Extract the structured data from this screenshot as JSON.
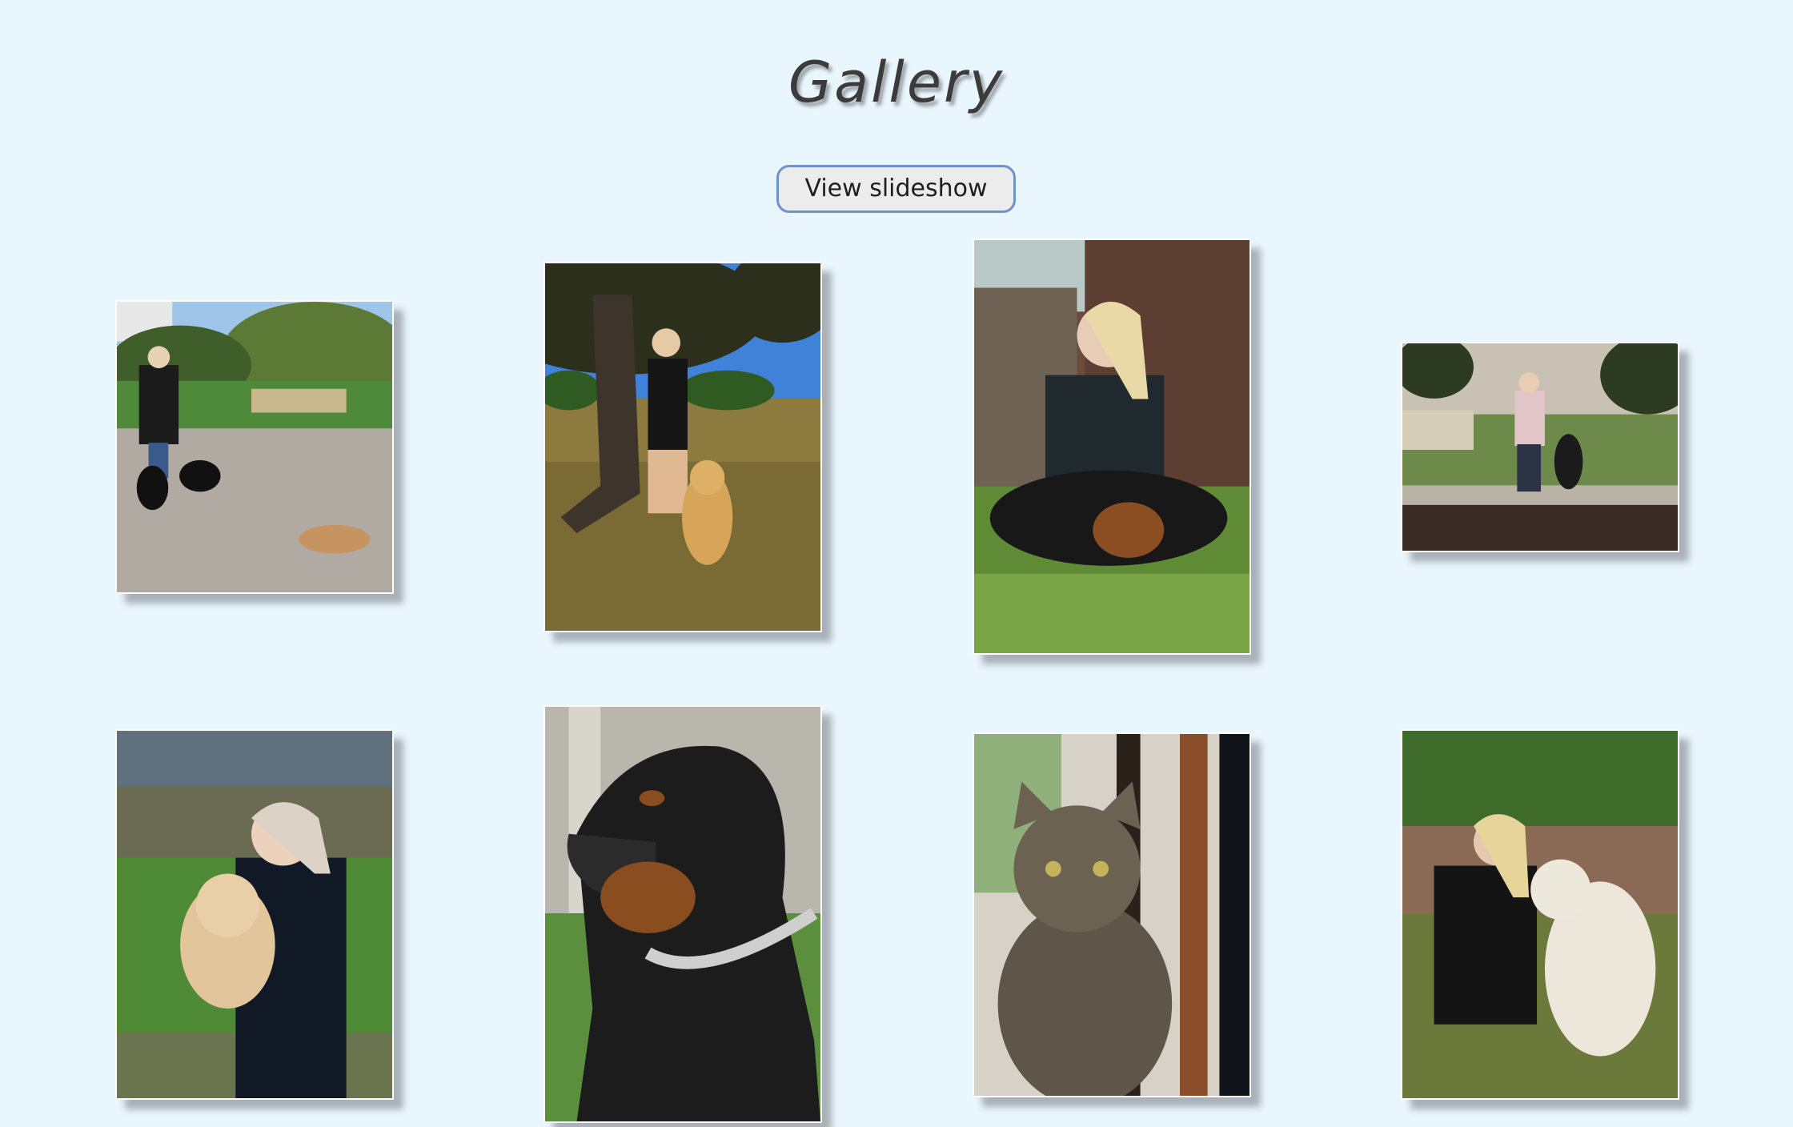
{
  "page": {
    "title": "Gallery",
    "slideshow_button_label": "View slideshow",
    "background_color": "#eaf6fe"
  },
  "gallery": {
    "photos": [
      {
        "subject": "woman-with-three-dogs-in-park"
      },
      {
        "subject": "woman-with-golden-retriever-under-tree"
      },
      {
        "subject": "woman-with-rottweiler-on-grass"
      },
      {
        "subject": "woman-with-rottweiler-by-water"
      },
      {
        "subject": "woman-holding-cockapoo-puppy"
      },
      {
        "subject": "rottweiler-portrait"
      },
      {
        "subject": "tabby-cat-portrait"
      },
      {
        "subject": "woman-with-white-dog-by-log"
      }
    ]
  },
  "colors": {
    "button_border": "#6e93c9",
    "button_fill": "#ececec",
    "title_text": "#3b3b3b"
  }
}
